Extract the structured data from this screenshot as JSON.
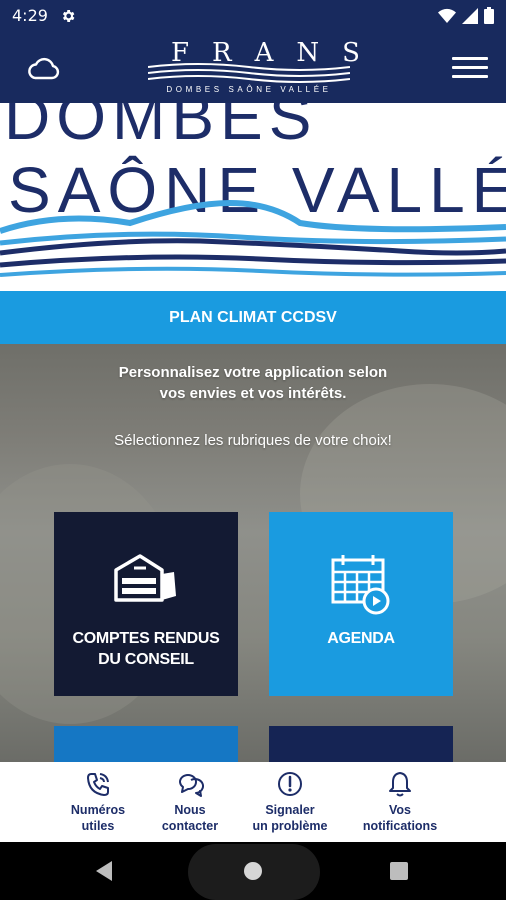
{
  "status_bar": {
    "time": "4:29"
  },
  "header": {
    "logo_word": "FRANS",
    "logo_subtitle": "DOMBES SAÔNE VALLÉE"
  },
  "hero": {
    "line1": "DOMBES",
    "line2": "SAÔNE VALLÉE"
  },
  "banner": {
    "label": "PLAN CLIMAT CCDSV"
  },
  "intro": {
    "line1": "Personnalisez votre application selon",
    "line2": "vos envies et vos intérêts.",
    "select_prompt": "Sélectionnez les rubriques de votre choix!"
  },
  "tiles": [
    {
      "line1": "COMPTES RENDUS",
      "line2": "DU CONSEIL",
      "icon": "building-icon"
    },
    {
      "line1": "AGENDA",
      "icon": "calendar-clock-icon"
    }
  ],
  "bottom_nav": [
    {
      "line1": "Numéros",
      "line2": "utiles",
      "icon": "phone-icon"
    },
    {
      "line1": "Nous",
      "line2": "contacter",
      "icon": "chat-icon"
    },
    {
      "line1": "Signaler",
      "line2": "un problème",
      "icon": "alert-icon"
    },
    {
      "line1": "Vos",
      "line2": "notifications",
      "icon": "bell-icon"
    }
  ],
  "colors": {
    "navy": "#182a5e",
    "accent_blue": "#1a9be0",
    "tile_dark": "#131a33"
  }
}
